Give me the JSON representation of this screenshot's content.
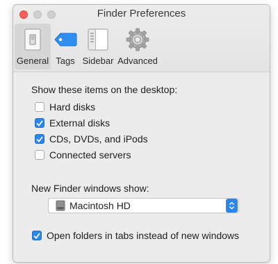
{
  "window": {
    "title": "Finder Preferences",
    "tabs": [
      {
        "label": "General",
        "icon": "general-switch-icon",
        "selected": true
      },
      {
        "label": "Tags",
        "icon": "tag-icon",
        "selected": false
      },
      {
        "label": "Sidebar",
        "icon": "sidebar-icon",
        "selected": false
      },
      {
        "label": "Advanced",
        "icon": "gear-icon",
        "selected": false
      }
    ]
  },
  "desktop": {
    "heading": "Show these items on the desktop:",
    "items": [
      {
        "label": "Hard disks",
        "checked": false
      },
      {
        "label": "External disks",
        "checked": true
      },
      {
        "label": "CDs, DVDs, and iPods",
        "checked": true
      },
      {
        "label": "Connected servers",
        "checked": false
      }
    ]
  },
  "new_window": {
    "heading": "New Finder windows show:",
    "selected": "Macintosh HD",
    "icon": "hard-drive-icon"
  },
  "tabs_option": {
    "label": "Open folders in tabs instead of new windows",
    "checked": true
  },
  "colors": {
    "accent": "#2b86ea",
    "tag_blue": "#2f8ef0",
    "close_red": "#fc605c"
  }
}
